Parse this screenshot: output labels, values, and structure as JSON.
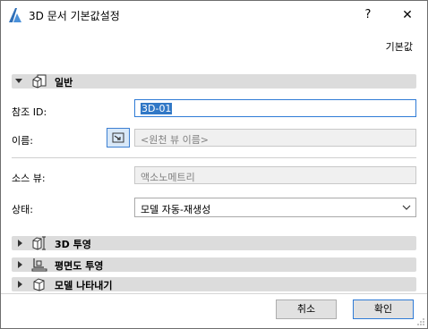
{
  "window": {
    "title": "3D 문서 기본값설정",
    "help_label": "?",
    "close_label": "✕"
  },
  "default_link": "기본값",
  "sections": {
    "general": {
      "label": "일반"
    },
    "projection3d": {
      "label": "3D 투영"
    },
    "floorplan": {
      "label": "평면도 투영"
    },
    "model_display": {
      "label": "모델 나타내기"
    }
  },
  "fields": {
    "ref_id": {
      "label": "참조 ID:",
      "value": "3D-01"
    },
    "name": {
      "label": "이름:",
      "placeholder": "<원천 뷰 이름>"
    },
    "source_view": {
      "label": "소스 뷰:",
      "value": "액소노메트리"
    },
    "status": {
      "label": "상태:",
      "value": "모델 자동-재생성"
    }
  },
  "buttons": {
    "cancel": "취소",
    "ok": "확인"
  },
  "colors": {
    "accent": "#2f7bd6",
    "selection": "#3178c6",
    "section_bar": "#dcdcdc"
  },
  "icons": {
    "app": "archicad-icon",
    "general": "cube-page-icon",
    "projection3d": "3d-projection-icon",
    "floorplan": "floorplan-projection-icon",
    "model_display": "cube-icon",
    "link": "link-arrow-icon"
  }
}
